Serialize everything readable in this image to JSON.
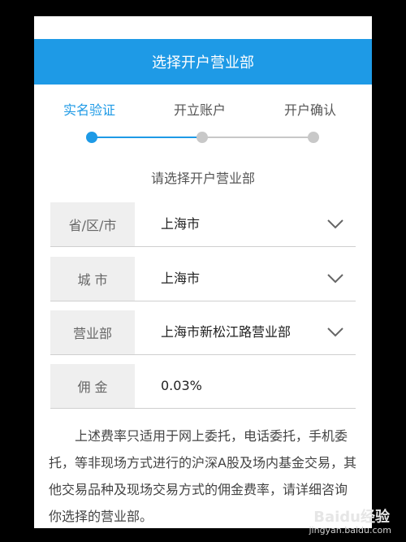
{
  "header": {
    "title": "选择开户营业部"
  },
  "steps": [
    {
      "label": "实名验证",
      "active": true
    },
    {
      "label": "开立账户",
      "active": false
    },
    {
      "label": "开户确认",
      "active": false
    }
  ],
  "colors": {
    "accent": "#1e9ae6",
    "inactive": "#c8c8c8",
    "label_bg": "#efefef"
  },
  "subtitle": "请选择开户营业部",
  "form": {
    "rows": [
      {
        "label": "省/区/市",
        "value": "上海市",
        "has_dropdown": true
      },
      {
        "label": "城 市",
        "value": "上海市",
        "has_dropdown": true
      },
      {
        "label": "营业部",
        "value": "上海市新松江路营业部",
        "has_dropdown": true
      },
      {
        "label": "佣 金",
        "value": "0.03%",
        "has_dropdown": false
      }
    ]
  },
  "note": "上述费率只适用于网上委托，电话委托，手机委托，等非现场方式进行的沪深A股及场内基金交易，其他交易品种及现场交易方式的佣金费率，请详细咨询你选择的营业部。",
  "watermark": {
    "main": "Baidu经验",
    "sub": "jingyan.baidu.com"
  },
  "icons": {
    "dropdown": "chevron-down-icon"
  }
}
